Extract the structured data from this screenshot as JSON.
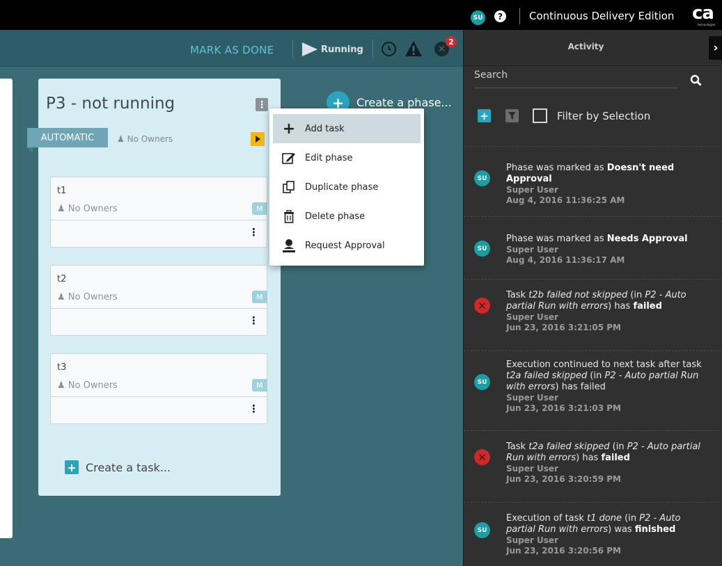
{
  "topbar": {
    "user_initials": "SU",
    "help_icon": "?",
    "edition": "Continuous Delivery Edition",
    "logo_main": "ca",
    "logo_sub": "technologies"
  },
  "toolbar": {
    "mark_done": "MARK AS DONE",
    "status": "Running",
    "error_count": "2"
  },
  "phase": {
    "title": "P3 - not running",
    "menu_icon": "⋮",
    "type_tag": "AUTOMATIC",
    "owners": "No Owners",
    "tasks": [
      {
        "name": "t1",
        "owners": "No Owners",
        "badge": "M",
        "menu": "⋮"
      },
      {
        "name": "t2",
        "owners": "No Owners",
        "badge": "M",
        "menu": "⋮"
      },
      {
        "name": "t3",
        "owners": "No Owners",
        "badge": "M",
        "menu": "⋮"
      }
    ],
    "create_task": "Create a task..."
  },
  "create_phase": "Create a phase...",
  "phase_menu": {
    "items": [
      {
        "label": "Add task",
        "icon": "plus-icon",
        "active": true
      },
      {
        "label": "Edit phase",
        "icon": "edit-icon"
      },
      {
        "label": "Duplicate phase",
        "icon": "duplicate-icon"
      },
      {
        "label": "Delete phase",
        "icon": "trash-icon"
      },
      {
        "label": "Request Approval",
        "icon": "user-stamp-icon"
      }
    ]
  },
  "activity": {
    "title": "Activity",
    "search_placeholder": "Search",
    "filter_label": "Filter by Selection",
    "entries": [
      {
        "kind": "su",
        "user": "Super User",
        "time": "Aug 4, 2016 11:36:25 AM"
      },
      {
        "kind": "su",
        "user": "Super User",
        "time": "Aug 4, 2016 11:36:17 AM"
      },
      {
        "kind": "error",
        "user": "Super User",
        "time": "Jun 23, 2016 3:21:05 PM"
      },
      {
        "kind": "su",
        "user": "Super User",
        "time": "Jun 23, 2016 3:21:03 PM"
      },
      {
        "kind": "error",
        "user": "Super User",
        "time": "Jun 23, 2016 3:20:59 PM"
      },
      {
        "kind": "su",
        "user": "Super User",
        "time": "Jun 23, 2016 3:20:56 PM"
      }
    ],
    "messages": {
      "e0": {
        "a": "Phase  was marked as ",
        "b": "Doesn't need Approval"
      },
      "e1": {
        "a": "Phase  was marked as ",
        "b": "Needs Approval"
      },
      "e2": {
        "a": "Task ",
        "i1": "t2b failed not skipped",
        "c": " (in ",
        "i2": "P2 - Auto partial Run with errors",
        "d": ") has ",
        "b": "failed"
      },
      "e3": {
        "a": "Execution continued to next task after task ",
        "i1": "t2a failed skipped",
        "c": " (in ",
        "i2": "P2 - Auto partial Run with errors",
        "d": ") has failed"
      },
      "e4": {
        "a": "Task ",
        "i1": "t2a failed skipped",
        "c": " (in ",
        "i2": "P2 - Auto partial Run with errors",
        "d": ") has ",
        "b": "failed"
      },
      "e5": {
        "a": "Execution of task ",
        "i1": "t1 done",
        "c": " (in ",
        "i2": "P2 - Auto partial Run with errors",
        "d": ") was ",
        "b": "finished"
      }
    }
  }
}
